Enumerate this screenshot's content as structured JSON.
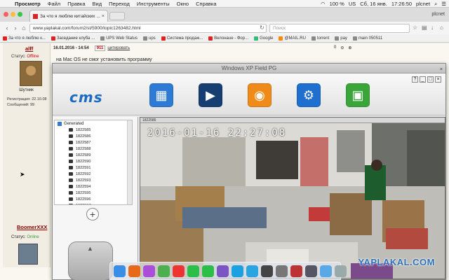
{
  "menubar": {
    "app": "Просмотр",
    "items": [
      "Файл",
      "Правка",
      "Вид",
      "Переход",
      "Инструменты",
      "Окно",
      "Справка"
    ],
    "battery": "100 %",
    "input_source": "US",
    "date": "Сб, 16 янв.",
    "time": "17:26:50",
    "user": "plcnet"
  },
  "browser": {
    "tab_title": "За что я люблю китайских ...",
    "url": "www.yaplakal.com/forum2/st/5900/topic1263482.html",
    "search_placeholder": "Поиск",
    "profile": "plcnet",
    "bookmarks": [
      {
        "label": "За что я люблю к...",
        "color": "#d22"
      },
      {
        "label": "Заседание клуба ...",
        "color": "#d22"
      },
      {
        "label": "UPS Web Status",
        "color": "#888"
      },
      {
        "label": "ups",
        "color": "#888"
      },
      {
        "label": "Системa продаж...",
        "color": "#d22"
      },
      {
        "label": "Велонаuе - Фор...",
        "color": "#d22"
      },
      {
        "label": "Google",
        "color": "#3b7"
      },
      {
        "label": "@MAIL.RU",
        "color": "#f80"
      },
      {
        "label": "torrent",
        "color": "#888"
      },
      {
        "label": "pay",
        "color": "#888"
      },
      {
        "label": "main 050511",
        "color": "#888"
      }
    ]
  },
  "forum": {
    "user1": {
      "name": "alff",
      "status_label": "Статус:",
      "status": "Offline",
      "caption": "Шутник",
      "registered": "Регистрация: 22.10.08",
      "messages": "Сообщений: 99"
    },
    "post": {
      "date": "16.01.2016 - 14:54",
      "number": "911",
      "quote": "цитировать",
      "text": "на Мас OS не смог установить программу",
      "rating": "0"
    },
    "user2": {
      "name": "BoomerXXX",
      "status_label": "Статус:",
      "status": "Online"
    }
  },
  "cms": {
    "window_title": "Windows XP Field PG",
    "logo": "cms",
    "toolbar_buttons": [
      {
        "name": "config-icon",
        "color": "#2e7bd6",
        "glyph": "⚙"
      },
      {
        "name": "playback-icon",
        "color": "#1f5fa8",
        "glyph": "🎬"
      },
      {
        "name": "alarm-icon",
        "color": "#f08a18",
        "glyph": "◉"
      },
      {
        "name": "settings-icon",
        "color": "#1e6fd0",
        "glyph": "⚙"
      },
      {
        "name": "lock-icon",
        "color": "#3aa63a",
        "glyph": "🔒"
      }
    ],
    "tree": {
      "root": "Generated",
      "items": [
        "1822585",
        "1822586",
        "1822587",
        "1822588",
        "1822589",
        "1822590",
        "1822591",
        "1822592",
        "1822593",
        "1822594",
        "1822595",
        "1822596",
        "1822597"
      ]
    },
    "video_label": "1822586",
    "timestamp": "2016-01-16  22:27:08",
    "watermark": "YAPLAKAL.COM"
  },
  "dock": [
    {
      "name": "finder-icon",
      "color": "#3a8ee6"
    },
    {
      "name": "firefox-icon",
      "color": "#e66a1a"
    },
    {
      "name": "photos-icon",
      "color": "#aa4dd8"
    },
    {
      "name": "maps-icon",
      "color": "#4caf50"
    },
    {
      "name": "calendar-icon",
      "color": "#e33"
    },
    {
      "name": "messages-icon",
      "color": "#2bbf4a"
    },
    {
      "name": "mail-icon",
      "color": "#2bbf4a"
    },
    {
      "name": "viber-icon",
      "color": "#7b55c4"
    },
    {
      "name": "skype-icon",
      "color": "#1ba1e2"
    },
    {
      "name": "telegram-icon",
      "color": "#2ba5e2"
    },
    {
      "name": "activity-icon",
      "color": "#444"
    },
    {
      "name": "system-icon",
      "color": "#777"
    },
    {
      "name": "app-icon",
      "color": "#b33"
    },
    {
      "name": "app2-icon",
      "color": "#556"
    },
    {
      "name": "folder-icon",
      "color": "#5aa9e6"
    },
    {
      "name": "trash-icon",
      "color": "#9aa"
    }
  ]
}
